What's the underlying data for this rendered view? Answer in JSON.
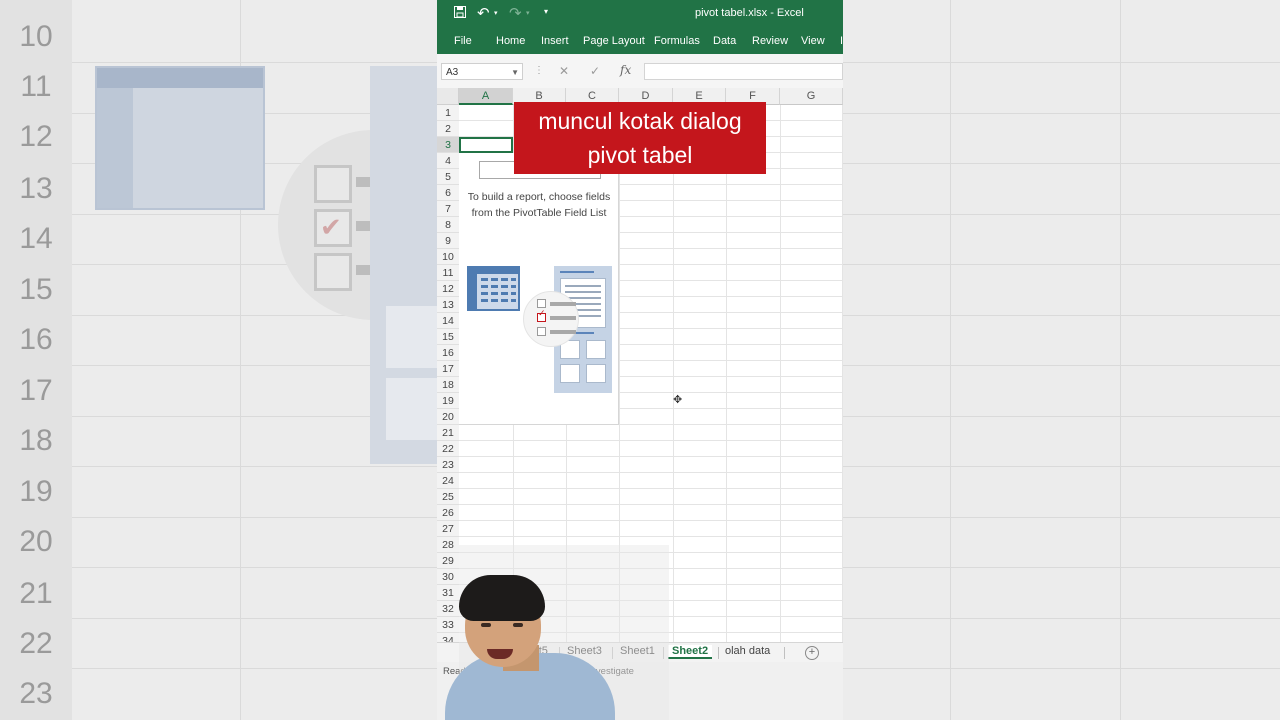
{
  "background": {
    "row_numbers": [
      "10",
      "11",
      "12",
      "13",
      "14",
      "15",
      "16",
      "17",
      "18",
      "19",
      "20",
      "21",
      "22",
      "23"
    ]
  },
  "window": {
    "title": "pivot tabel.xlsx  -  Excel",
    "icons": [
      "save-icon",
      "undo-icon",
      "redo-icon",
      "customize-qat-icon"
    ]
  },
  "ribbon": {
    "tabs": [
      "File",
      "Home",
      "Insert",
      "Page Layout",
      "Formulas",
      "Data",
      "Review",
      "View"
    ]
  },
  "formula_bar": {
    "name_box": "A3",
    "fx_label": "fx",
    "value": ""
  },
  "grid": {
    "columns": [
      "A",
      "B",
      "C",
      "D",
      "E",
      "F",
      "G"
    ],
    "rows": [
      "1",
      "2",
      "3",
      "4",
      "5",
      "6",
      "7",
      "8",
      "9",
      "10",
      "11",
      "12",
      "13",
      "14",
      "15",
      "16",
      "17",
      "18",
      "19",
      "20",
      "21",
      "22",
      "23",
      "24",
      "25",
      "26",
      "27",
      "28",
      "29",
      "30",
      "31",
      "32",
      "33",
      "34"
    ],
    "selected_cell": "A3"
  },
  "pivot_placeholder": {
    "line1": "To build a report, choose fields",
    "line2": "from the PivotTable Field List"
  },
  "caption": {
    "line1": "muncul kotak dialog",
    "line2": "pivot tabel",
    "color": "#c4161c"
  },
  "sheet_tabs": {
    "tabs": [
      "Sheet5",
      "Sheet3",
      "Sheet1",
      "Sheet2",
      "olah data"
    ],
    "active": "Sheet2"
  },
  "status": {
    "ready": "Ready",
    "accessibility": "Accessibility: Investigate"
  },
  "colors": {
    "excel_green": "#217346"
  }
}
